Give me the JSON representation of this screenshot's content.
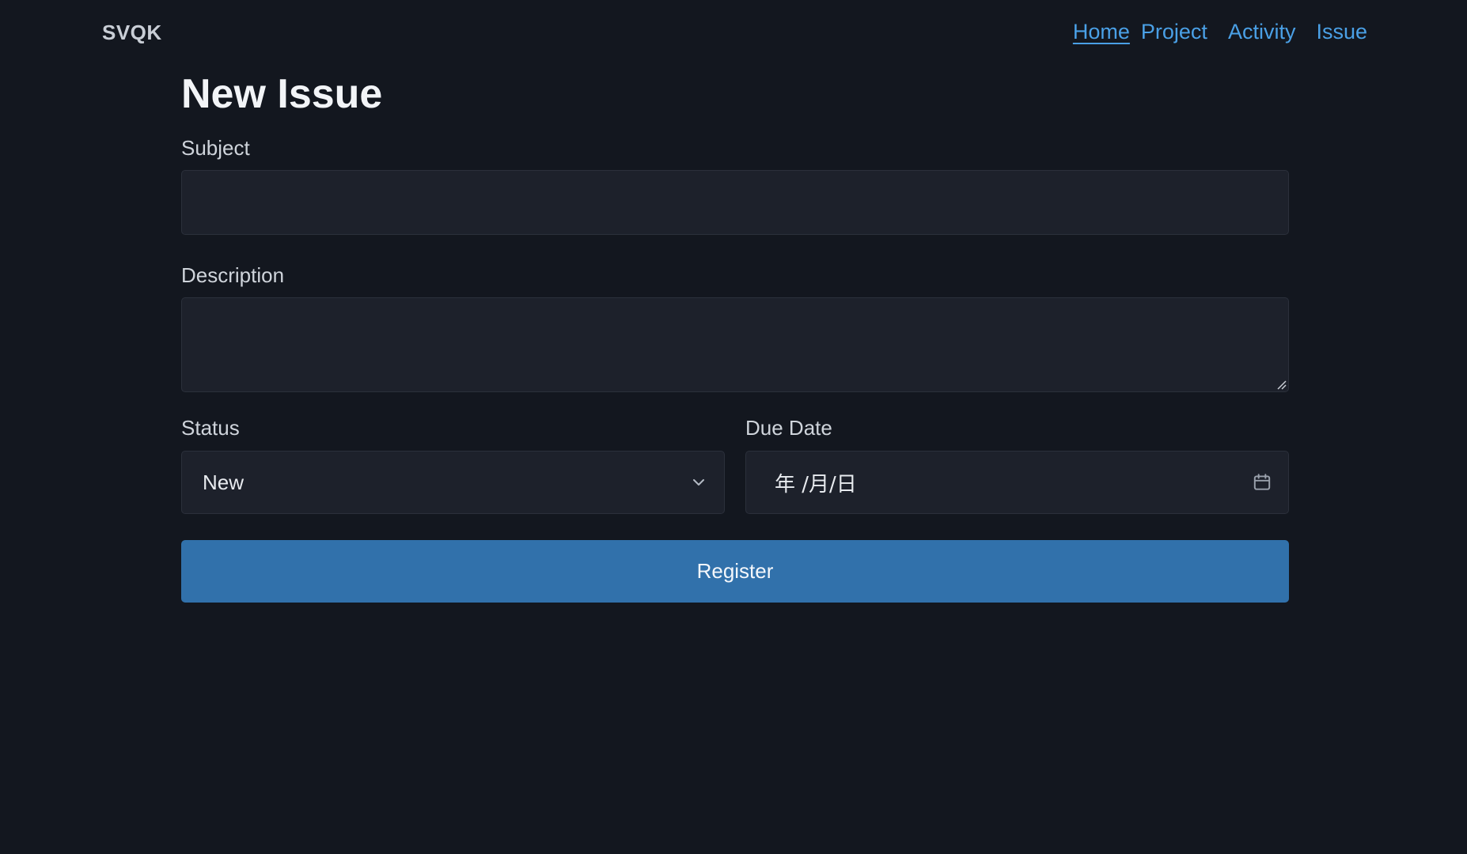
{
  "header": {
    "brand": "SVQK",
    "nav": [
      {
        "label": "Home",
        "active": true
      },
      {
        "label": "Project",
        "active": false
      },
      {
        "label": "Activity",
        "active": false
      },
      {
        "label": "Issue",
        "active": false
      }
    ]
  },
  "form": {
    "title": "New Issue",
    "subject": {
      "label": "Subject",
      "value": "",
      "placeholder": ""
    },
    "description": {
      "label": "Description",
      "value": "",
      "placeholder": ""
    },
    "status": {
      "label": "Status",
      "value": "New",
      "icon": "chevron-down-icon"
    },
    "due_date": {
      "label": "Due Date",
      "value": "年 /月/日",
      "icon": "calendar-icon"
    },
    "submit_label": "Register"
  },
  "colors": {
    "background": "#13171f",
    "input_background": "#1d212b",
    "link": "#4aa0e6",
    "primary_button": "#3171ab"
  }
}
